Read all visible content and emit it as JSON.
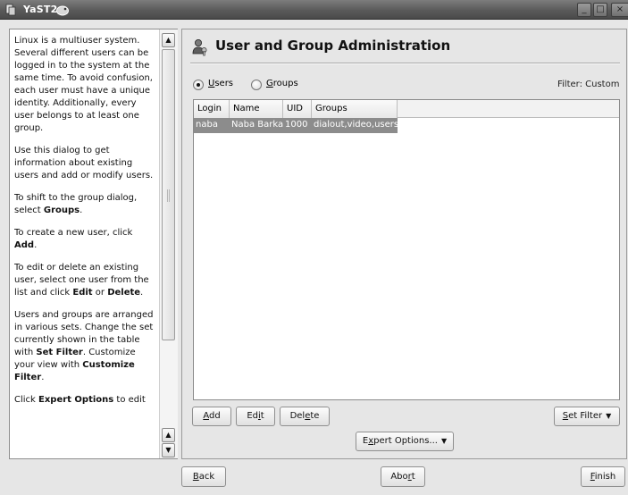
{
  "window": {
    "title": "YaST2",
    "icon": "yast-icon",
    "logo": "suse-logo",
    "controls": {
      "minimize": "_",
      "maximize": "□",
      "close": "×"
    }
  },
  "help": {
    "p1": "Linux is a multiuser system. Several different users can be logged in to the system at the same time. To avoid confusion, each user must have a unique identity. Additionally, every user belongs to at least one group.",
    "p2": "Use this dialog to get information about existing users and add or modify users.",
    "p3_pre": "To shift to the group dialog, select ",
    "p3_b": "Groups",
    "p3_post": ".",
    "p4_pre": "To create a new user, click ",
    "p4_b": "Add",
    "p4_post": ".",
    "p5_pre": "To edit or delete an existing user, select one user from the list and click ",
    "p5_b1": "Edit",
    "p5_mid": " or ",
    "p5_b2": "Delete",
    "p5_post": ".",
    "p6_pre": "Users and groups are arranged in various sets. Change the set currently shown in the table with ",
    "p6_b1": "Set Filter",
    "p6_mid": ". Customize your view with ",
    "p6_b2": "Customize Filter",
    "p6_post": ".",
    "p7_pre": "Click ",
    "p7_b": "Expert Options",
    "p7_post": " to edit"
  },
  "header": {
    "title": "User and Group Administration",
    "icon": "users-icon"
  },
  "view_selector": {
    "users": {
      "underline": "U",
      "rest": "sers",
      "selected": true
    },
    "groups": {
      "underline": "G",
      "rest": "roups",
      "selected": false
    }
  },
  "filter_label": "Filter: Custom",
  "table": {
    "columns": [
      "Login",
      "Name",
      "UID",
      "Groups"
    ],
    "rows": [
      {
        "login": "naba",
        "name": "Naba Barkakati",
        "uid": "1000",
        "groups": "dialout,video,users",
        "selected": true
      }
    ]
  },
  "buttons": {
    "add": {
      "underline": "A",
      "rest": "dd"
    },
    "edit": {
      "pre": "Ed",
      "underline": "i",
      "rest": "t"
    },
    "delete": {
      "pre": "Del",
      "underline": "e",
      "rest": "te"
    },
    "set_filter": {
      "underline": "S",
      "rest": "et Filter"
    },
    "expert_options": {
      "pre": "E",
      "underline": "x",
      "rest": "pert Options..."
    },
    "back": {
      "underline": "B",
      "rest": "ack"
    },
    "abort": {
      "pre": "Abo",
      "underline": "r",
      "rest": "t"
    },
    "finish": {
      "underline": "F",
      "rest": "inish"
    }
  },
  "colors": {
    "selection": "#8c8c8c",
    "titlebar": "#5a5a5a",
    "panel": "#e6e6e6"
  }
}
